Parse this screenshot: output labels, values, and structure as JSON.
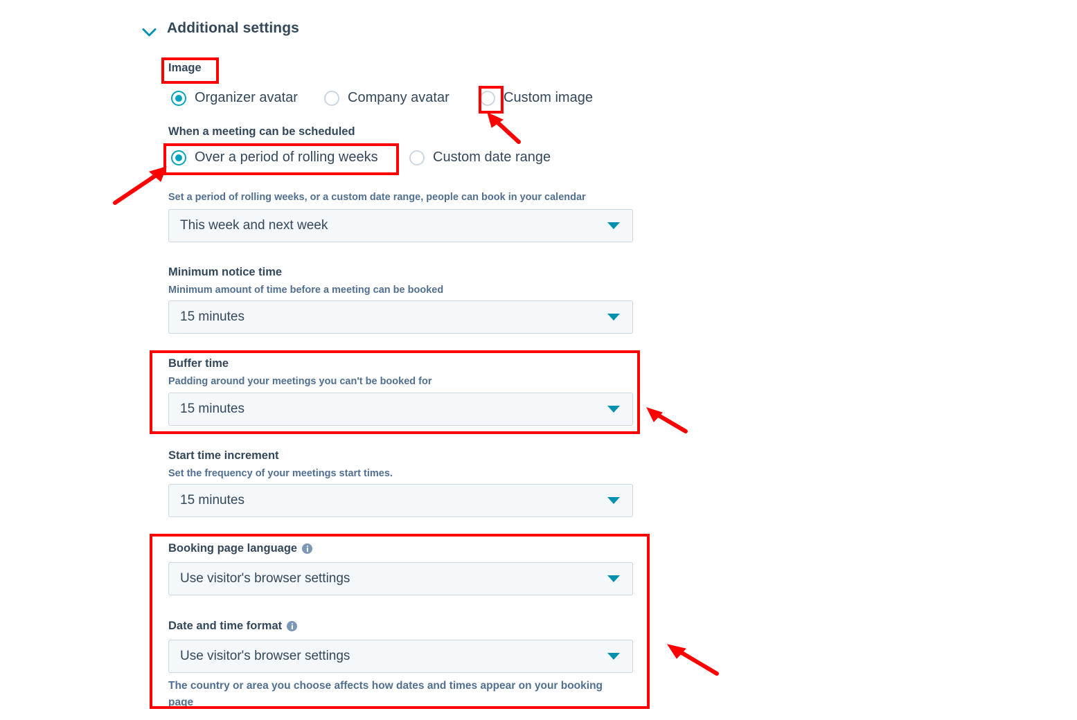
{
  "section": {
    "title": "Additional settings",
    "collapse_icon": "chevron-down-icon"
  },
  "image_field": {
    "label": "Image",
    "options": [
      {
        "label": "Organizer avatar",
        "selected": true
      },
      {
        "label": "Company avatar",
        "selected": false
      },
      {
        "label": "Custom image",
        "selected": false
      }
    ]
  },
  "scheduling_window": {
    "label": "When a meeting can be scheduled",
    "options": [
      {
        "label": "Over a period of rolling weeks",
        "selected": true
      },
      {
        "label": "Custom date range",
        "selected": false
      }
    ],
    "help": "Set a period of rolling weeks, or a custom date range, people can book in your calendar",
    "select_value": "This week and next week"
  },
  "minimum_notice_time": {
    "label": "Minimum notice time",
    "help": "Minimum amount of time before a meeting can be booked",
    "select_value": "15 minutes"
  },
  "buffer_time": {
    "label": "Buffer time",
    "help": "Padding around your meetings you can't be booked for",
    "select_value": "15 minutes"
  },
  "start_time_increment": {
    "label": "Start time increment",
    "help": "Set the frequency of your meetings start times.",
    "select_value": "15 minutes"
  },
  "booking_page_language": {
    "label": "Booking page language",
    "info_icon": "info-icon",
    "select_value": "Use visitor's browser settings"
  },
  "date_and_time_format": {
    "label": "Date and time format",
    "info_icon": "info-icon",
    "select_value": "Use visitor's browser settings",
    "help": "The country or area you choose affects how dates and times appear on your booking page"
  },
  "colors": {
    "accent_teal": "#00a4bd",
    "caret_teal": "#0091ae",
    "text": "#33475b",
    "muted_text": "#516f90",
    "field_bg": "#f5f8fa",
    "field_border": "#cbd6e2",
    "annotation_red": "#fe0000"
  },
  "annotations": {
    "highlight_boxes": [
      "image-label-box",
      "custom-image-radio-box",
      "rolling-weeks-radio-box",
      "buffer-time-box",
      "language-and-format-box"
    ],
    "arrows": [
      "arrow-to-custom-image-radio",
      "arrow-to-rolling-weeks-radio",
      "arrow-to-buffer-time",
      "arrow-to-date-format"
    ]
  }
}
